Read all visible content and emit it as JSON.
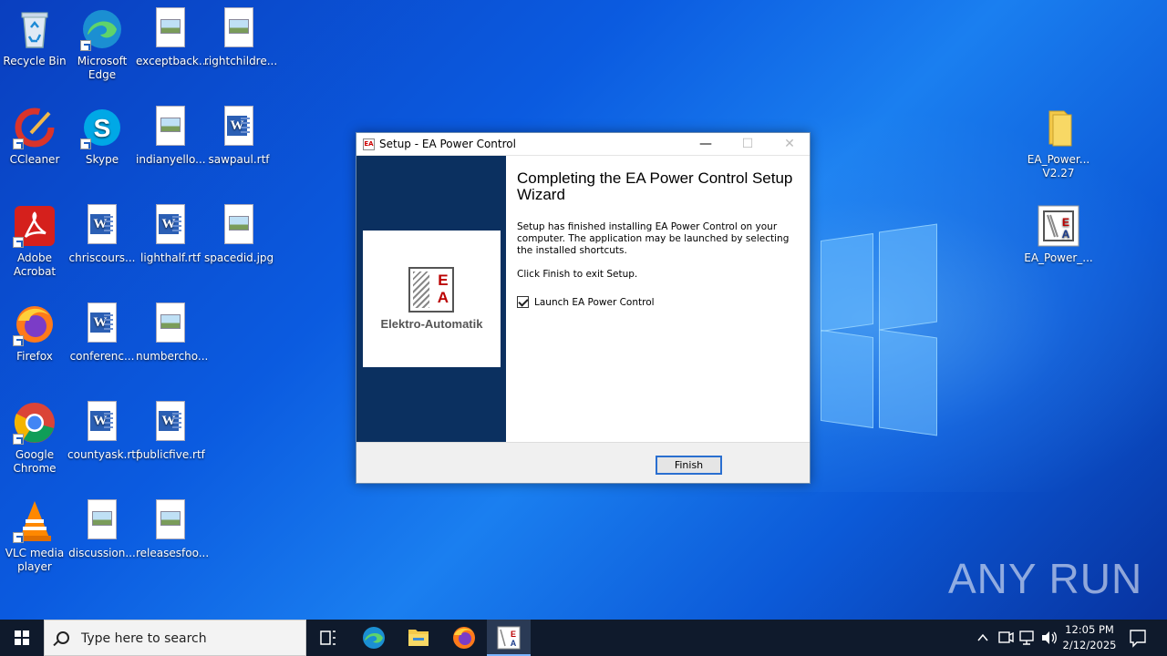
{
  "desktop": {
    "icons": [
      {
        "label": "Recycle Bin",
        "icon": "recycle-bin-icon"
      },
      {
        "label": "Microsoft Edge",
        "icon": "edge-icon"
      },
      {
        "label": "exceptback...",
        "icon": "image-file-icon"
      },
      {
        "label": "rightchildre...",
        "icon": "image-file-icon"
      },
      {
        "label": "CCleaner",
        "icon": "ccleaner-icon"
      },
      {
        "label": "Skype",
        "icon": "skype-icon"
      },
      {
        "label": "indianyello...",
        "icon": "image-file-icon"
      },
      {
        "label": "sawpaul.rtf",
        "icon": "word-doc-icon"
      },
      {
        "label": "Adobe Acrobat",
        "icon": "acrobat-icon"
      },
      {
        "label": "chriscours...",
        "icon": "word-doc-icon"
      },
      {
        "label": "lighthalf.rtf",
        "icon": "word-doc-icon"
      },
      {
        "label": "spacedid.jpg",
        "icon": "image-file-icon"
      },
      {
        "label": "Firefox",
        "icon": "firefox-icon"
      },
      {
        "label": "conferenc...",
        "icon": "word-doc-icon"
      },
      {
        "label": "numbercho...",
        "icon": "image-file-icon"
      },
      {
        "label": "Google Chrome",
        "icon": "chrome-icon"
      },
      {
        "label": "countyask.rtf",
        "icon": "word-doc-icon"
      },
      {
        "label": "publicfive.rtf",
        "icon": "word-doc-icon"
      },
      {
        "label": "VLC media player",
        "icon": "vlc-icon"
      },
      {
        "label": "discussion...",
        "icon": "image-file-icon"
      },
      {
        "label": "releasesfoo...",
        "icon": "image-file-icon"
      },
      {
        "label": "EA_Power... V2.27",
        "icon": "folder-icon"
      },
      {
        "label": "EA_Power_...",
        "icon": "ea-app-icon"
      }
    ]
  },
  "dialog": {
    "title": "Setup - EA Power Control",
    "logo_text": "Elektro-Automatik",
    "heading": "Completing the EA Power Control Setup Wizard",
    "body": "Setup has finished installing EA Power Control on your computer. The application may be launched by selecting the installed shortcuts.",
    "instruction": "Click Finish to exit Setup.",
    "checkbox_label": "Launch EA Power Control",
    "checkbox_checked": true,
    "finish_label": "Finish",
    "minimize": "—",
    "maximize": "☐",
    "close": "✕"
  },
  "watermark": "ANY RUN",
  "taskbar": {
    "search_placeholder": "Type here to search",
    "pinned": [
      "task-view-icon",
      "edge-icon",
      "file-explorer-icon",
      "firefox-icon",
      "ea-app-icon"
    ],
    "time": "12:05 PM",
    "date": "2/12/2025"
  },
  "colors": {
    "dialog_sidebar": "#0b3060",
    "taskbar": "#0f1a2c",
    "accent": "#2a6fd0"
  }
}
